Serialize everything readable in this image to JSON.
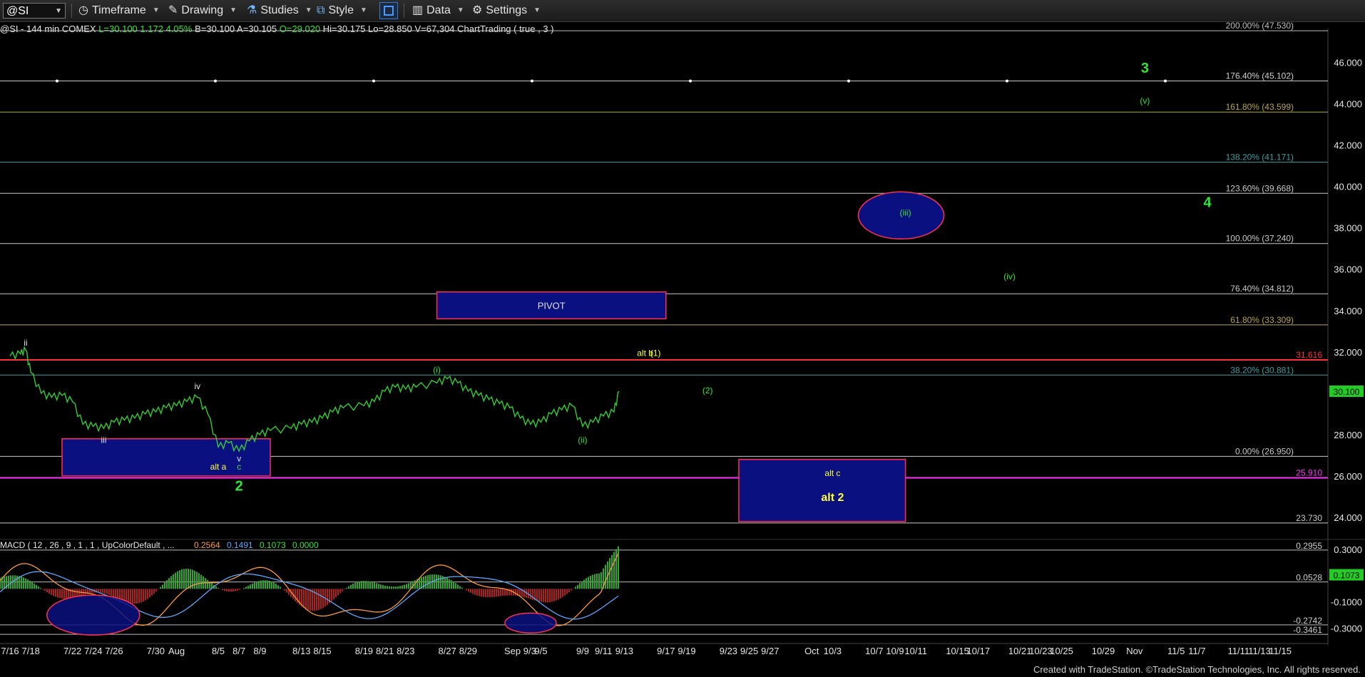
{
  "toolbar": {
    "symbol": "@SI",
    "timeframe": "Timeframe",
    "drawing": "Drawing",
    "studies": "Studies",
    "style": "Style",
    "data": "Data",
    "settings": "Settings"
  },
  "infobar": {
    "symbol": "@SI - 144 min  COMEX",
    "last": "L=30.100",
    "change": "1.172",
    "change_pct": "4.05%",
    "bid": "B=30.100",
    "ask": "A=30.105",
    "open": "O=29.020",
    "high": "Hi=30.175",
    "low": "Lo=28.850",
    "volume": "V=67,304",
    "analysis": "ChartTrading ( true , 3 )"
  },
  "footer": "Created with TradeStation. ©TradeStation Technologies, Inc. All rights reserved.",
  "chart_data": {
    "type": "line",
    "price_panel": {
      "ylim": [
        23.0,
        47.5
      ],
      "y_ticks": [
        "24.000",
        "26.000",
        "28.000",
        "30.000",
        "32.000",
        "34.000",
        "36.000",
        "38.000",
        "40.000",
        "42.000",
        "44.000",
        "46.000"
      ],
      "last_price": "30.100",
      "price_series": [
        {
          "date": "7/16",
          "y": 31.8
        },
        {
          "date": "7/17",
          "y": 31.9
        },
        {
          "date": "7/17.5",
          "y": 32.1
        },
        {
          "date": "7/18",
          "y": 31.0
        },
        {
          "date": "7/19",
          "y": 30.0
        },
        {
          "date": "7/20",
          "y": 29.8
        },
        {
          "date": "7/21",
          "y": 29.9
        },
        {
          "date": "7/22",
          "y": 29.6
        },
        {
          "date": "7/23",
          "y": 28.5
        },
        {
          "date": "7/24",
          "y": 28.4
        },
        {
          "date": "7/25",
          "y": 28.3
        },
        {
          "date": "7/26",
          "y": 28.6
        },
        {
          "date": "7/27",
          "y": 28.7
        },
        {
          "date": "7/28",
          "y": 28.8
        },
        {
          "date": "7/29",
          "y": 29.0
        },
        {
          "date": "7/30",
          "y": 29.1
        },
        {
          "date": "7/31",
          "y": 29.3
        },
        {
          "date": "8/1",
          "y": 29.4
        },
        {
          "date": "8/2",
          "y": 29.6
        },
        {
          "date": "8/3",
          "y": 29.8
        },
        {
          "date": "8/4",
          "y": 29.0
        },
        {
          "date": "8/5",
          "y": 27.4
        },
        {
          "date": "8/6",
          "y": 27.6
        },
        {
          "date": "8/7",
          "y": 27.2
        },
        {
          "date": "8/8",
          "y": 27.7
        },
        {
          "date": "8/9",
          "y": 28.0
        },
        {
          "date": "8/10",
          "y": 28.2
        },
        {
          "date": "8/12",
          "y": 28.3
        },
        {
          "date": "8/13",
          "y": 28.5
        },
        {
          "date": "8/14",
          "y": 28.6
        },
        {
          "date": "8/15",
          "y": 28.8
        },
        {
          "date": "8/16",
          "y": 29.1
        },
        {
          "date": "8/17",
          "y": 29.3
        },
        {
          "date": "8/19",
          "y": 29.4
        },
        {
          "date": "8/20",
          "y": 29.6
        },
        {
          "date": "8/21",
          "y": 30.1
        },
        {
          "date": "8/22",
          "y": 30.3
        },
        {
          "date": "8/23",
          "y": 30.2
        },
        {
          "date": "8/24",
          "y": 30.3
        },
        {
          "date": "8/26",
          "y": 30.5
        },
        {
          "date": "8/27",
          "y": 30.7
        },
        {
          "date": "8/28",
          "y": 30.5
        },
        {
          "date": "8/29",
          "y": 30.1
        },
        {
          "date": "8/30",
          "y": 29.9
        },
        {
          "date": "8/31",
          "y": 29.7
        },
        {
          "date": "9/1",
          "y": 29.5
        },
        {
          "date": "9/2",
          "y": 29.3
        },
        {
          "date": "9/3",
          "y": 28.8
        },
        {
          "date": "9/4",
          "y": 28.5
        },
        {
          "date": "9/5",
          "y": 28.6
        },
        {
          "date": "9/6",
          "y": 29.0
        },
        {
          "date": "9/7",
          "y": 29.2
        },
        {
          "date": "9/8",
          "y": 29.4
        },
        {
          "date": "9/9",
          "y": 28.4
        },
        {
          "date": "9/10",
          "y": 28.6
        },
        {
          "date": "9/11",
          "y": 28.9
        },
        {
          "date": "9/12",
          "y": 29.1
        },
        {
          "date": "9/12.5",
          "y": 30.1
        }
      ],
      "horizontal_levels": [
        {
          "label": "200.00% (47.530)",
          "value": 47.53,
          "color": "#bdbdbd"
        },
        {
          "label": "176.40% (45.102)",
          "value": 45.102,
          "color": "#d0d0d0"
        },
        {
          "label": "161.80% (43.599)",
          "value": 43.599,
          "color": "#b9a64a"
        },
        {
          "label": "138.20% (41.171)",
          "value": 41.171,
          "color": "#3e9ea0"
        },
        {
          "label": "123.60% (39.668)",
          "value": 39.668,
          "color": "#c9c9c9"
        },
        {
          "label": "100.00% (37.240)",
          "value": 37.24,
          "color": "#c9c9c9"
        },
        {
          "label": "76.40% (34.812)",
          "value": 34.812,
          "color": "#c9c9c9"
        },
        {
          "label": "61.80% (33.309)",
          "value": 33.309,
          "color": "#b9a64a"
        },
        {
          "label": "31.616",
          "value": 31.616,
          "color": "#ff3030"
        },
        {
          "label": "38.20% (30.881)",
          "value": 30.881,
          "color": "#3e9ea0"
        },
        {
          "label": "0.00% (26.950)",
          "value": 26.95,
          "color": "#c9c9c9"
        },
        {
          "label": "25.910",
          "value": 25.91,
          "color": "#ff33ff"
        },
        {
          "label": "23.730",
          "value": 23.73,
          "color": "#c9c9c9"
        }
      ],
      "annotations": [
        {
          "text": "ii",
          "date": "7/17.5",
          "y": 32.3,
          "color": "#e0e0e0"
        },
        {
          "text": "iii",
          "date": "7/25",
          "y": 27.6,
          "color": "#e0e0e0"
        },
        {
          "text": "iv",
          "date": "8/3",
          "y": 30.2,
          "color": "#e0e0e0"
        },
        {
          "text": "v",
          "date": "8/7",
          "y": 26.7,
          "color": "#e0e0e0"
        },
        {
          "text": "c",
          "date": "8/7",
          "y": 26.3,
          "color": "#33e633"
        },
        {
          "text": "alt a",
          "date": "8/5",
          "y": 26.3,
          "color": "#ffff33"
        },
        {
          "text": "2",
          "date": "8/7",
          "y": 25.3,
          "color": "#33e633"
        },
        {
          "text": "(i)",
          "date": "8/26",
          "y": 31.0,
          "color": "#33e633"
        },
        {
          "text": "(ii)",
          "date": "9/9",
          "y": 27.6,
          "color": "#33e633"
        },
        {
          "text": "alt b",
          "date": "9/15",
          "y": 31.8,
          "color": "#ffff33"
        },
        {
          "text": "(1)",
          "date": "9/16",
          "y": 31.8,
          "color": "#ffff33"
        },
        {
          "text": "(2)",
          "date": "9/21",
          "y": 30.0,
          "color": "#33e633"
        },
        {
          "text": "(iii)",
          "date": "10/10",
          "y": 38.6,
          "color": "#33e633"
        },
        {
          "text": "(iv)",
          "date": "10/20",
          "y": 35.5,
          "color": "#33e633"
        },
        {
          "text": "(v)",
          "date": "11/2",
          "y": 44.0,
          "color": "#33e633"
        },
        {
          "text": "3",
          "date": "11/2",
          "y": 45.5,
          "color": "#33e633"
        },
        {
          "text": "4",
          "date": "11/8",
          "y": 39.0,
          "color": "#33e633"
        },
        {
          "text": "alt c",
          "date": "10/3",
          "y": 26.0,
          "color": "#ffff33"
        },
        {
          "text": "alt 2",
          "date": "10/3",
          "y": 24.8,
          "color": "#ffff33"
        }
      ],
      "boxes": [
        {
          "label": "PIVOT",
          "x0": "8/26",
          "x1": "9/17",
          "y0": 33.6,
          "y1": 34.9
        },
        {
          "label": "",
          "x0": "7/21",
          "x1": "8/10",
          "y0": 26.0,
          "y1": 27.8
        },
        {
          "label": "",
          "x0": "9/24",
          "x1": "10/10",
          "y0": 23.8,
          "y1": 26.8
        }
      ]
    },
    "macd_panel": {
      "title": "MACD ( 12 , 26 , 9 , 1 , 1 , UpColorDefault , ...",
      "macd": "0.2564",
      "signal": "0.1491",
      "diff": "0.1073",
      "zero": "0.0000",
      "ylim": [
        -0.4,
        0.36
      ],
      "y_ticks": [
        "0.3000",
        "-0.1000",
        "-0.3000"
      ],
      "levels": [
        {
          "label": "0.2955",
          "value": 0.2955
        },
        {
          "label": "0.0528",
          "value": 0.0528
        },
        {
          "label": "-0.2742",
          "value": -0.2742
        },
        {
          "label": "-0.3461",
          "value": -0.3461
        }
      ]
    },
    "x_ticks": [
      "7/16",
      "7/18",
      "7/22",
      "7/24",
      "7/26",
      "7/30",
      "Aug",
      "8/5",
      "8/7",
      "8/9",
      "8/13",
      "8/15",
      "8/19",
      "8/21",
      "8/23",
      "8/27",
      "8/29",
      "Sep 9/3",
      "9/5",
      "9/9",
      "9/11",
      "9/13",
      "9/17",
      "9/19",
      "9/23",
      "9/25",
      "9/27",
      "Oct",
      "10/3",
      "10/7",
      "10/9",
      "10/11",
      "10/15",
      "10/17",
      "10/21",
      "10/23",
      "10/25",
      "10/29",
      "Nov",
      "11/5",
      "11/7",
      "11/11",
      "11/13",
      "11/15"
    ]
  }
}
